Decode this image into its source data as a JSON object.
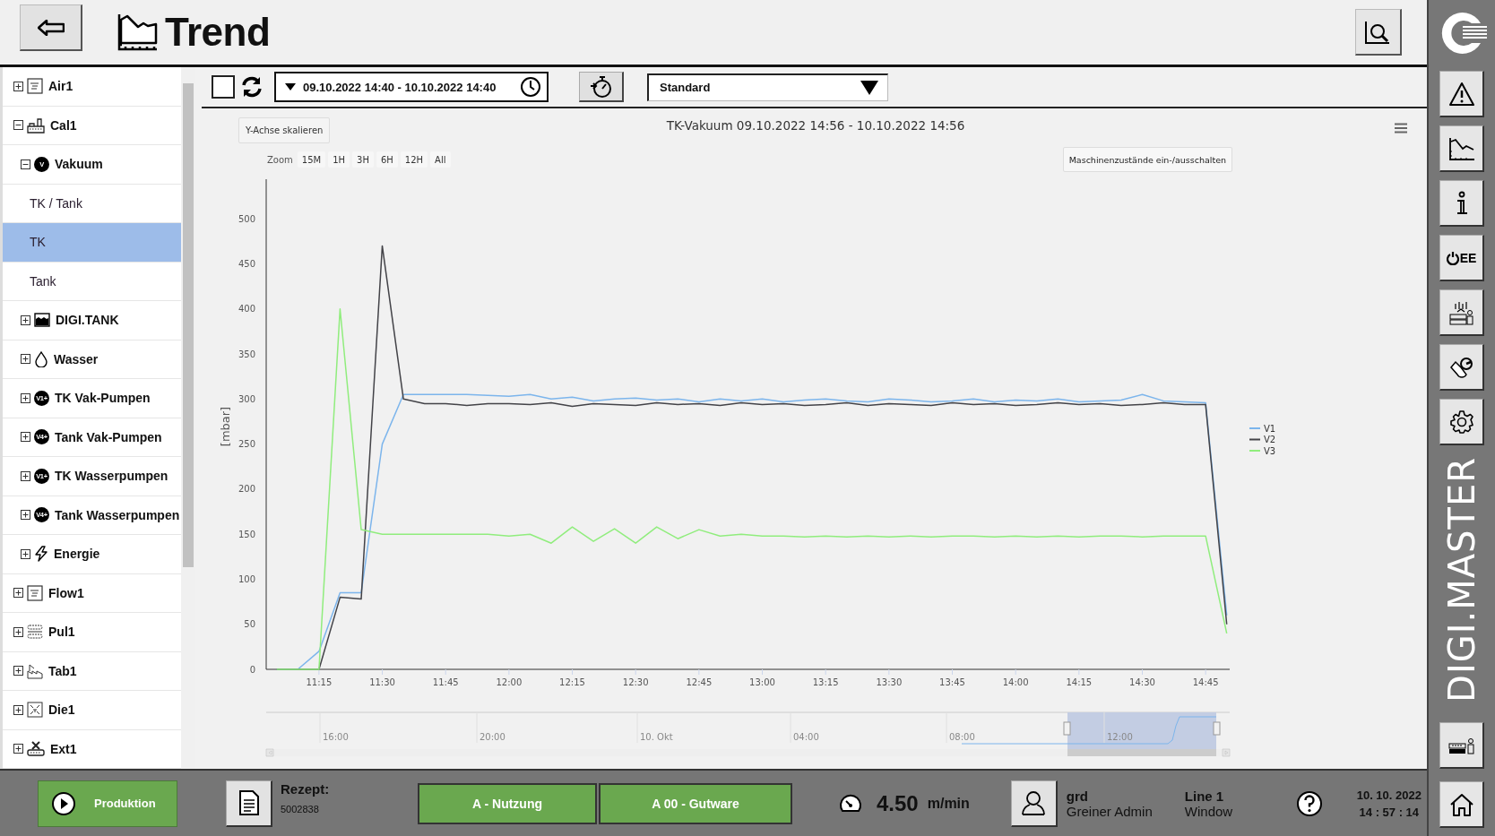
{
  "header": {
    "title": "Trend"
  },
  "sidebar": {
    "tree": [
      {
        "label": "Air1",
        "expanded": false,
        "selected": false
      },
      {
        "label": "Cal1",
        "expanded": true,
        "selected": false,
        "children": [
          {
            "label": "Vakuum",
            "badge": "V",
            "expanded": true,
            "selected": false,
            "children": [
              {
                "label": "TK / Tank",
                "selected": false
              },
              {
                "label": "TK",
                "selected": true
              },
              {
                "label": "Tank",
                "selected": false
              }
            ]
          },
          {
            "label": "DIGI.TANK",
            "expanded": false,
            "selected": false
          },
          {
            "label": "Wasser",
            "expanded": false,
            "selected": false
          },
          {
            "label": "TK Vak-Pumpen",
            "badge": "V1+",
            "expanded": false,
            "selected": false
          },
          {
            "label": "Tank Vak-Pumpen",
            "badge": "V4+",
            "expanded": false,
            "selected": false
          },
          {
            "label": "TK Wasserpumpen",
            "badge": "V1+",
            "expanded": false,
            "selected": false
          },
          {
            "label": "Tank Wasserpumpen",
            "badge": "V4+",
            "expanded": false,
            "selected": false
          },
          {
            "label": "Energie",
            "expanded": false,
            "selected": false
          }
        ]
      },
      {
        "label": "Flow1",
        "expanded": false,
        "selected": false
      },
      {
        "label": "Pul1",
        "expanded": false,
        "selected": false
      },
      {
        "label": "Tab1",
        "expanded": false,
        "selected": false
      },
      {
        "label": "Die1",
        "expanded": false,
        "selected": false
      },
      {
        "label": "Ext1",
        "expanded": false,
        "selected": false
      }
    ]
  },
  "toolbar": {
    "select_all": {
      "checked": false
    },
    "date_range": "09.10.2022 14:40 - 10.10.2022 14:40",
    "profile": "Standard"
  },
  "chart": {
    "scale_button": "Y-Achse skalieren",
    "title": "TK-Vakuum 09.10.2022 14:56 - 10.10.2022 14:56",
    "zoom_label": "Zoom",
    "zoom_buttons": [
      {
        "label": "15M",
        "selected": false
      },
      {
        "label": "1H",
        "selected": false
      },
      {
        "label": "3H",
        "selected": false
      },
      {
        "label": "6H",
        "selected": false
      },
      {
        "label": "12H",
        "selected": false
      },
      {
        "label": "All",
        "selected": false
      }
    ],
    "states_button": "Maschinenzustände ein-/ausschalten",
    "chart_data": {
      "type": "line",
      "ylabel": "[mbar]",
      "categories": [
        null,
        null,
        "11:15",
        null,
        null,
        "11:30",
        null,
        null,
        "11:45",
        null,
        null,
        "12:00",
        null,
        null,
        "12:15",
        null,
        null,
        "12:30",
        null,
        null,
        "12:45",
        null,
        null,
        "13:00",
        null,
        null,
        "13:15",
        null,
        null,
        "13:30",
        null,
        null,
        "13:45",
        null,
        null,
        "14:00",
        null,
        null,
        "14:15",
        null,
        null,
        "14:30",
        null,
        null,
        "14:45",
        null
      ],
      "series": [
        {
          "name": "V1",
          "color": "#7cb5ec",
          "values": [
            0,
            0,
            20,
            85,
            85,
            250,
            305,
            305,
            305,
            305,
            304,
            303,
            305,
            300,
            302,
            298,
            300,
            301,
            299,
            300,
            297,
            300,
            298,
            300,
            297,
            299,
            300,
            298,
            297,
            300,
            299,
            297,
            298,
            300,
            297,
            299,
            298,
            300,
            297,
            298,
            299,
            305,
            298,
            297,
            296,
            60
          ]
        },
        {
          "name": "V2",
          "color": "#434348",
          "values": [
            0,
            0,
            0,
            80,
            78,
            470,
            300,
            295,
            295,
            293,
            295,
            295,
            294,
            296,
            292,
            295,
            294,
            293,
            296,
            294,
            295,
            293,
            296,
            294,
            295,
            293,
            294,
            296,
            293,
            295,
            294,
            293,
            296,
            294,
            295,
            293,
            294,
            296,
            294,
            295,
            293,
            294,
            296,
            294,
            294,
            50
          ]
        },
        {
          "name": "V3",
          "color": "#90ed7d",
          "values": [
            0,
            0,
            0,
            400,
            155,
            150,
            150,
            150,
            150,
            150,
            150,
            148,
            150,
            140,
            158,
            142,
            156,
            140,
            158,
            145,
            155,
            148,
            150,
            148,
            148,
            147,
            148,
            147,
            148,
            147,
            148,
            147,
            148,
            148,
            147,
            148,
            147,
            148,
            147,
            148,
            148,
            147,
            148,
            148,
            148,
            40
          ]
        }
      ],
      "ylim": [
        0,
        544
      ],
      "legend": "right",
      "yticks": [
        0,
        50,
        100,
        150,
        200,
        250,
        300,
        350,
        400,
        450,
        500
      ]
    },
    "navigator": {
      "labels": [
        "16:00",
        "20:00",
        "10. Okt",
        "04:00",
        "08:00",
        "12:00"
      ]
    }
  },
  "footer": {
    "mode": "Produktion",
    "recipe_label": "Rezept:",
    "recipe_value": "5002838",
    "status_buttons": [
      "A - Nutzung",
      "A 00 - Gutware"
    ],
    "speed": "4.50",
    "speed_unit": "m/min",
    "user_name": "grd",
    "user_role": "Greiner Admin",
    "line_name": "Line 1",
    "line_sub": "Window",
    "date": "10. 10. 2022",
    "time": "14 : 57 : 14"
  },
  "rail": {
    "oee_label": "EE",
    "brand": "DIGI.MASTER"
  }
}
